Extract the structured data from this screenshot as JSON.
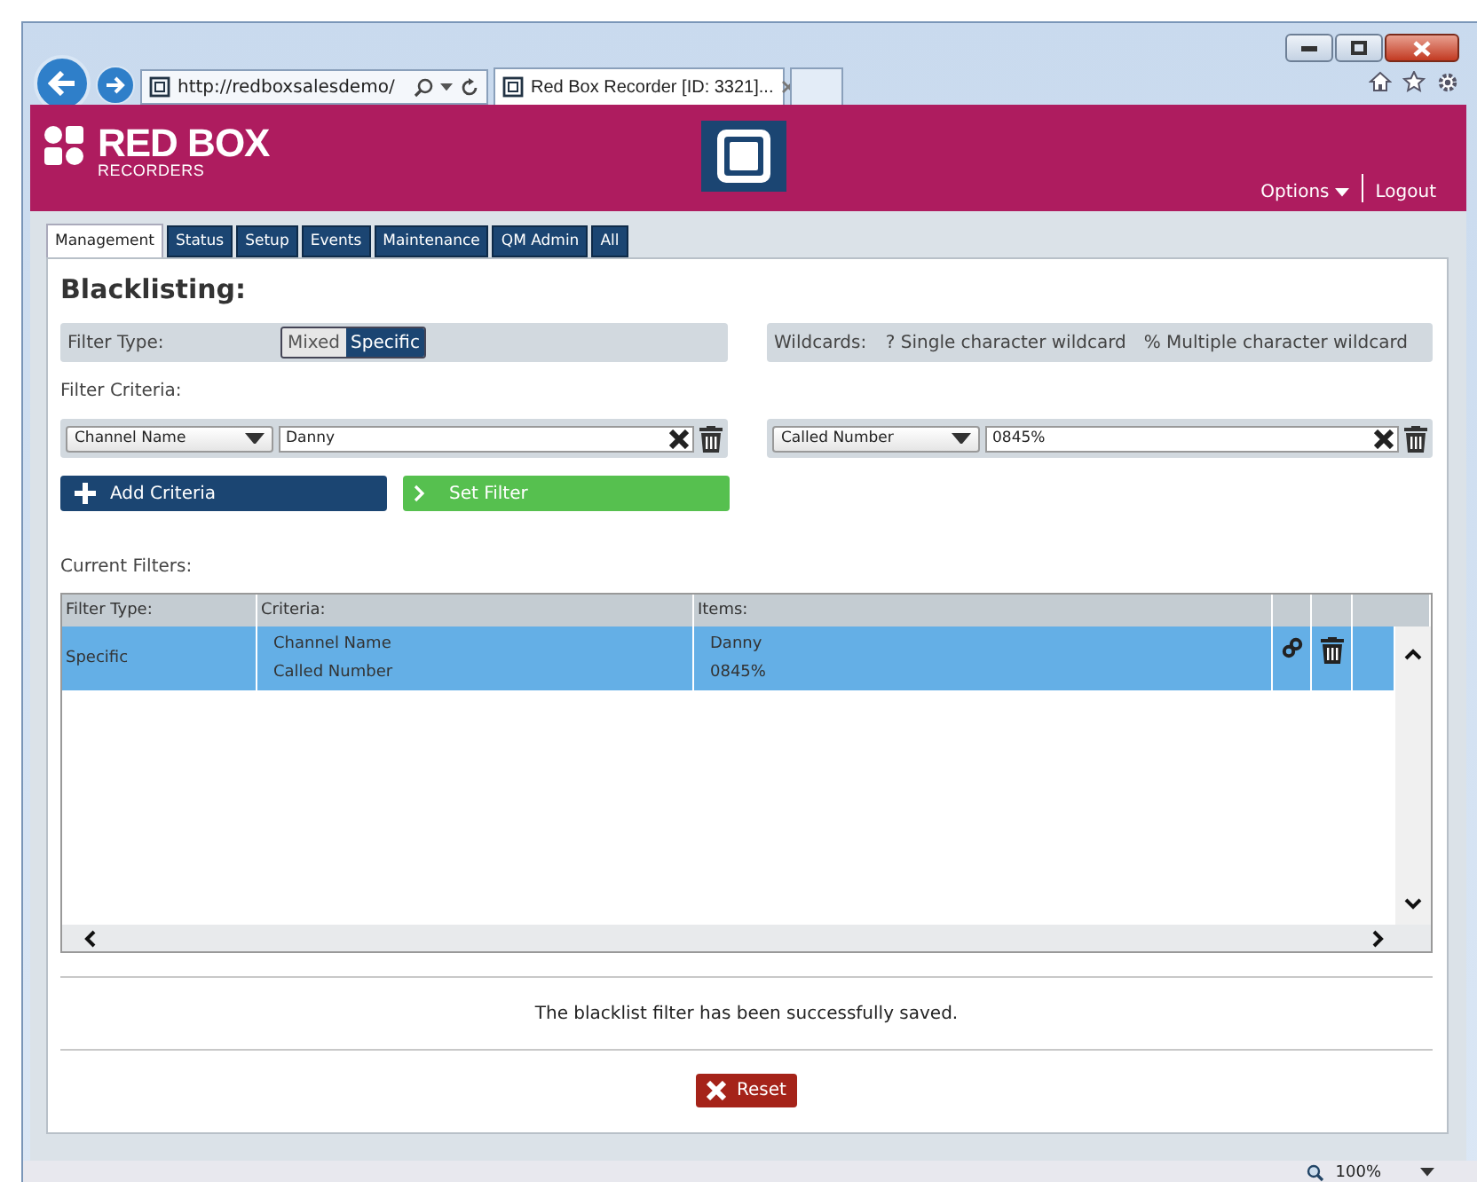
{
  "browser": {
    "address": "http://redboxsalesdemo/",
    "tab_title": "Red Box Recorder [ID: 3321]...",
    "zoom": "100%"
  },
  "header": {
    "logo_title": "RED BOX",
    "logo_subtitle": "RECORDERS",
    "menu": [
      {
        "label": "Options",
        "kind": "dropdown"
      },
      {
        "label": "Logout",
        "kind": "link"
      }
    ]
  },
  "tabs": [
    {
      "label": "Management",
      "selected": true
    },
    {
      "label": "Status",
      "selected": false
    },
    {
      "label": "Setup",
      "selected": false
    },
    {
      "label": "Events",
      "selected": false
    },
    {
      "label": "Maintenance",
      "selected": false
    },
    {
      "label": "QM Admin",
      "selected": false
    },
    {
      "label": "All",
      "selected": false
    }
  ],
  "page": {
    "title": "Blacklisting:",
    "filter_type": {
      "label": "Filter Type:",
      "options": [
        {
          "label": "Mixed",
          "selected": false
        },
        {
          "label": "Specific",
          "selected": true
        }
      ]
    },
    "wildcards": {
      "label": "Wildcards:",
      "items": [
        "? Single character wildcard",
        "% Multiple character wildcard"
      ]
    },
    "filter_criteria_label": "Filter Criteria:",
    "criteria": [
      {
        "field": "Channel Name",
        "value": "Danny"
      },
      {
        "field": "Called Number",
        "value": "0845%"
      }
    ],
    "add_button": "Add Criteria",
    "set_button": "Set Filter",
    "current_filters_label": "Current Filters:",
    "table": {
      "columns": [
        "Filter Type:",
        "Criteria:",
        "Items:"
      ],
      "rows": [
        {
          "filter_type": "Specific",
          "criteria": [
            "Channel Name",
            "Called Number"
          ],
          "items": [
            "Danny",
            "0845%"
          ],
          "selected": true
        }
      ]
    },
    "message": "The blacklist filter has been successfully saved.",
    "reset_button": "Reset"
  }
}
